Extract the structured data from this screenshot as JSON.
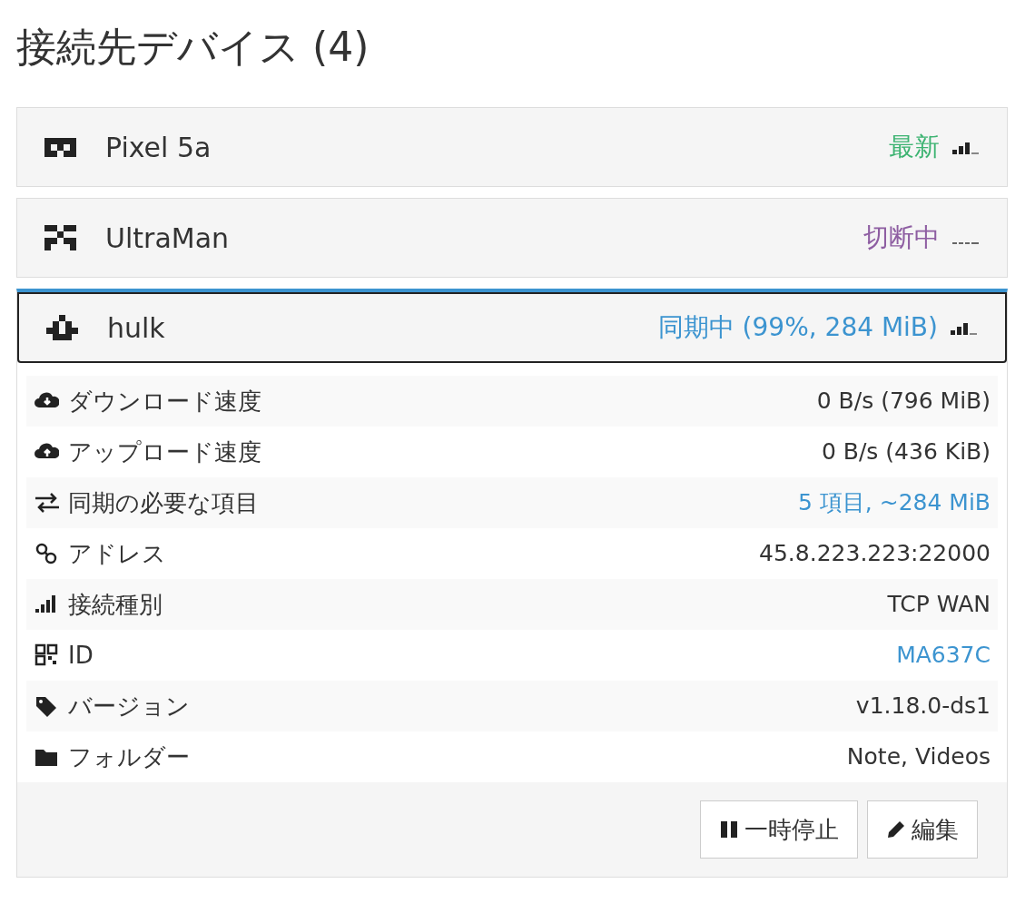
{
  "heading": "接続先デバイス (4)",
  "devices": [
    {
      "name": "Pixel 5a",
      "status": "最新",
      "color": "#3cb371",
      "connected": true,
      "expanded": false
    },
    {
      "name": "UltraMan",
      "status": "切断中",
      "color": "#8e5ea2",
      "connected": false,
      "expanded": false
    },
    {
      "name": "hulk",
      "status": "同期中 (99%, 284 MiB)",
      "color": "#3c94d0",
      "connected": true,
      "expanded": true,
      "details": [
        {
          "kind": "download",
          "label": "ダウンロード速度",
          "value": "0 B/s (796 MiB)",
          "link": false
        },
        {
          "kind": "upload",
          "label": "アップロード速度",
          "value": "0 B/s (436 KiB)",
          "link": false
        },
        {
          "kind": "sync",
          "label": "同期の必要な項目",
          "value": "5 項目, ~284 MiB",
          "link": true
        },
        {
          "kind": "address",
          "label": "アドレス",
          "value": "45.8.223.223:22000",
          "link": false
        },
        {
          "kind": "connection",
          "label": "接続種別",
          "value": "TCP WAN",
          "link": false
        },
        {
          "kind": "id",
          "label": "ID",
          "value": "MA637C",
          "link": true
        },
        {
          "kind": "version",
          "label": "バージョン",
          "value": "v1.18.0-ds1",
          "link": false
        },
        {
          "kind": "folders",
          "label": "フォルダー",
          "value": "Note, Videos",
          "link": false
        }
      ],
      "buttons": [
        {
          "kind": "pause",
          "label": "一時停止"
        },
        {
          "kind": "edit",
          "label": "編集"
        }
      ]
    }
  ]
}
